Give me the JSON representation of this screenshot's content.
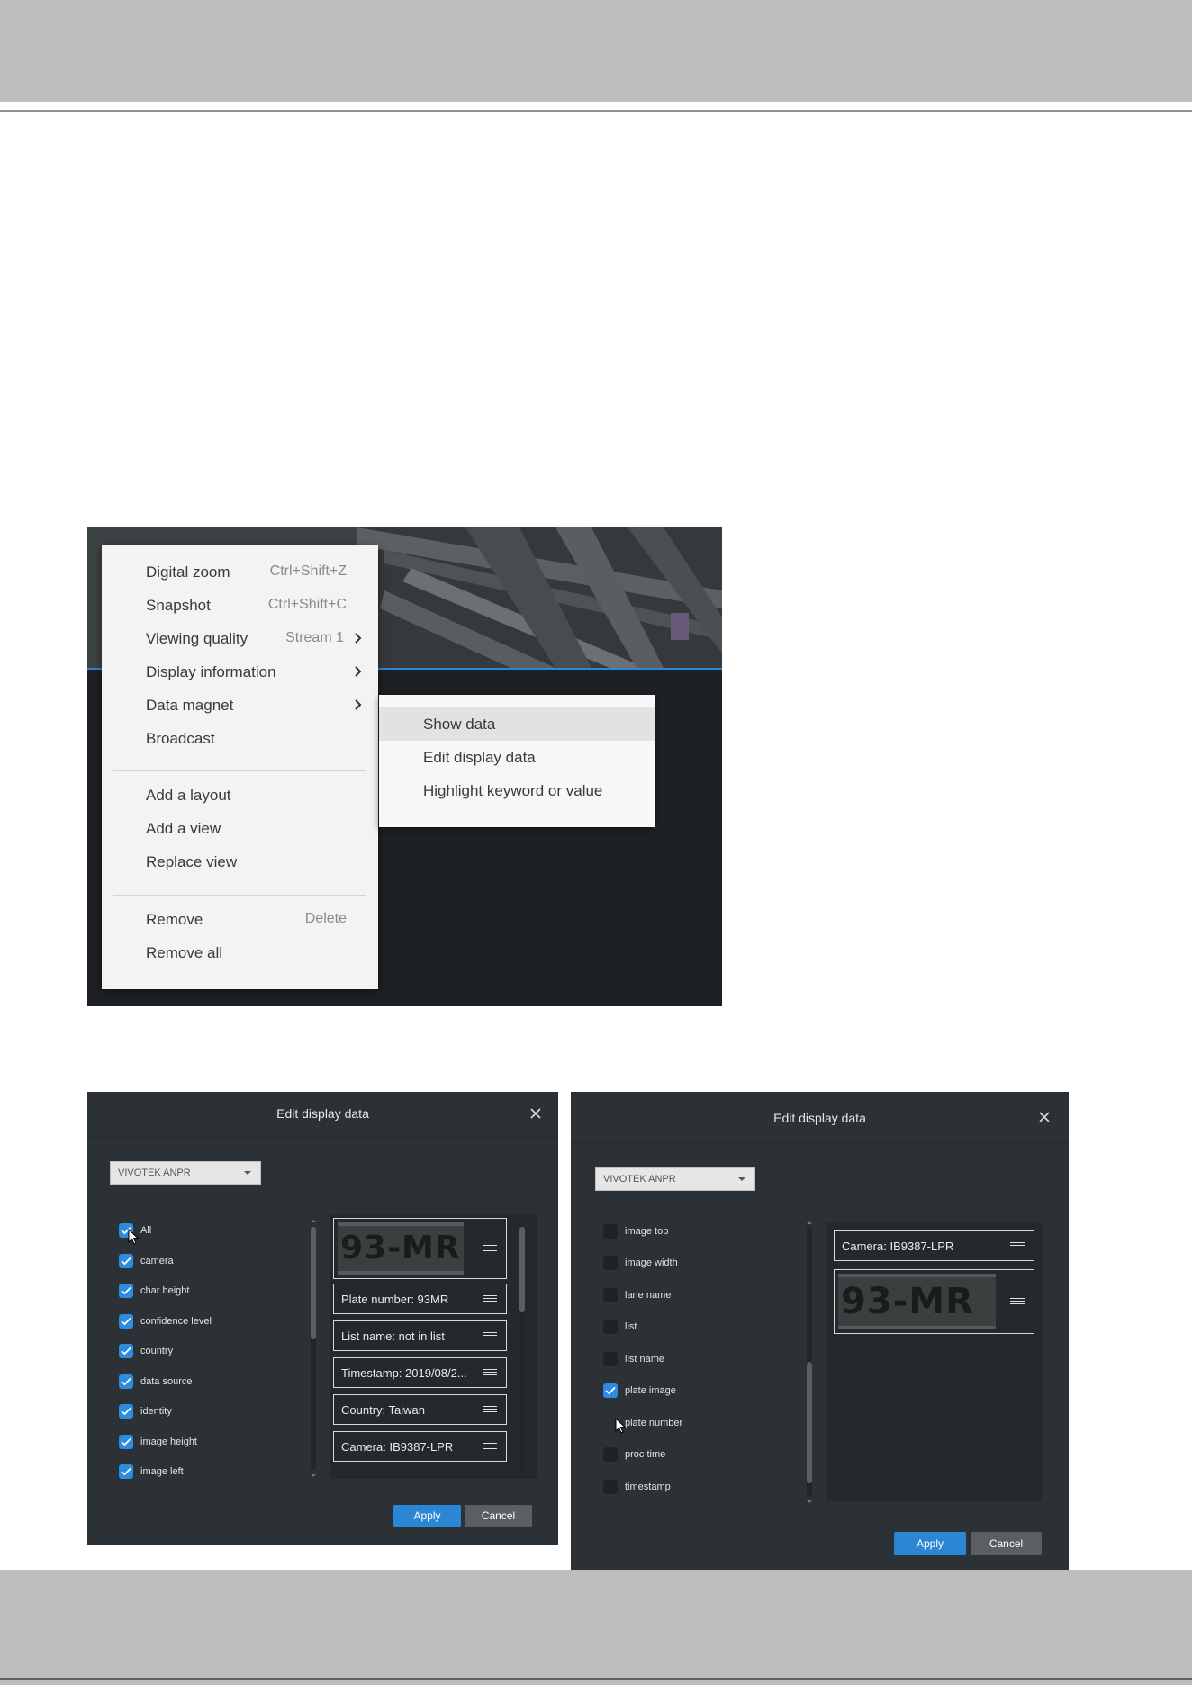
{
  "context_menu": {
    "items": [
      {
        "label": "Digital zoom",
        "shortcut": "Ctrl+Shift+Z",
        "has_submenu": false
      },
      {
        "label": "Snapshot",
        "shortcut": "Ctrl+Shift+C",
        "has_submenu": false
      },
      {
        "label": "Viewing quality",
        "shortcut": "Stream 1",
        "has_submenu": true
      },
      {
        "label": "Display information",
        "shortcut": "",
        "has_submenu": true
      },
      {
        "label": "Data magnet",
        "shortcut": "",
        "has_submenu": true
      },
      {
        "label": "Broadcast",
        "shortcut": "",
        "has_submenu": false
      },
      {
        "label": "Add a layout",
        "shortcut": "",
        "has_submenu": false
      },
      {
        "label": "Add a view",
        "shortcut": "",
        "has_submenu": false
      },
      {
        "label": "Replace view",
        "shortcut": "",
        "has_submenu": false
      },
      {
        "label": "Remove",
        "shortcut": "Delete",
        "has_submenu": false
      },
      {
        "label": "Remove all",
        "shortcut": "",
        "has_submenu": false
      }
    ],
    "submenu": {
      "items": [
        {
          "label": "Show data",
          "highlighted": true
        },
        {
          "label": "Edit display data",
          "highlighted": false
        },
        {
          "label": "Highlight keyword or value",
          "highlighted": false
        }
      ]
    }
  },
  "dialog_left": {
    "title": "Edit display data",
    "source_select": "VIVOTEK ANPR",
    "checkboxes": [
      {
        "label": "All",
        "checked": true
      },
      {
        "label": "camera",
        "checked": true
      },
      {
        "label": "char height",
        "checked": true
      },
      {
        "label": "confidence level",
        "checked": true
      },
      {
        "label": "country",
        "checked": true
      },
      {
        "label": "data source",
        "checked": true
      },
      {
        "label": "identity",
        "checked": true
      },
      {
        "label": "image height",
        "checked": true
      },
      {
        "label": "image left",
        "checked": true
      }
    ],
    "plate_image_text": "93-MR",
    "fields": [
      "Plate number: 93MR",
      "List name: not in list",
      "Timestamp: 2019/08/2...",
      "Country: Taiwan",
      "Camera: IB9387-LPR"
    ],
    "apply_label": "Apply",
    "cancel_label": "Cancel"
  },
  "dialog_right": {
    "title": "Edit display data",
    "source_select": "VIVOTEK ANPR",
    "checkboxes": [
      {
        "label": "image top",
        "checked": false
      },
      {
        "label": "image width",
        "checked": false
      },
      {
        "label": "lane name",
        "checked": false
      },
      {
        "label": "list",
        "checked": false
      },
      {
        "label": "list name",
        "checked": false
      },
      {
        "label": "plate image",
        "checked": true
      },
      {
        "label": "plate number",
        "checked": false
      },
      {
        "label": "proc time",
        "checked": false
      },
      {
        "label": "timestamp",
        "checked": false
      }
    ],
    "fields": [
      "Camera: IB9387-LPR"
    ],
    "plate_image_text": "93-MR",
    "apply_label": "Apply",
    "cancel_label": "Cancel"
  },
  "colors": {
    "accent": "#2b86d6",
    "dialog_bg": "#2c3135",
    "menu_bg": "#f3f3f3",
    "band_gray": "#bcbdbc"
  }
}
